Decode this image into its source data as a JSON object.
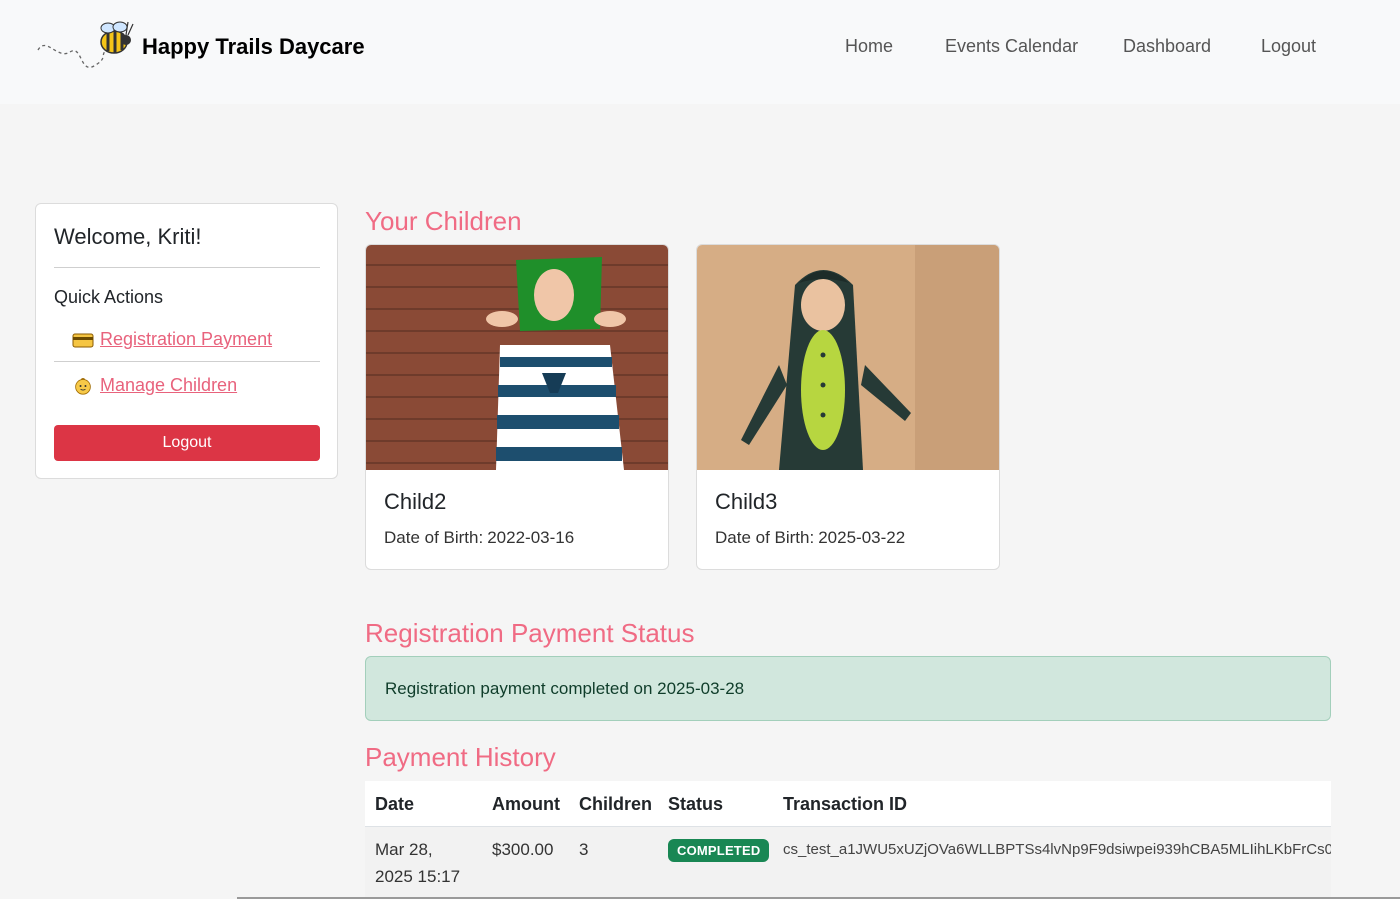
{
  "brand": {
    "name": "Happy Trails Daycare",
    "logo_icon": "bee-icon"
  },
  "nav": {
    "items": [
      {
        "label": "Home"
      },
      {
        "label": "Events Calendar"
      },
      {
        "label": "Dashboard"
      },
      {
        "label": "Logout"
      }
    ]
  },
  "sidebar": {
    "welcome": "Welcome, Kriti!",
    "quick_actions_title": "Quick Actions",
    "actions": [
      {
        "label": "Registration Payment",
        "icon": "credit-card-icon"
      },
      {
        "label": "Manage Children",
        "icon": "baby-icon"
      }
    ],
    "logout_label": "Logout"
  },
  "children_section": {
    "title": "Your Children",
    "children": [
      {
        "name": "Child2",
        "dob_label": "Date of Birth:",
        "dob": "2022-03-16"
      },
      {
        "name": "Child3",
        "dob_label": "Date of Birth:",
        "dob": "2025-03-22"
      }
    ]
  },
  "payment_status": {
    "title": "Registration Payment Status",
    "message": "Registration payment completed on 2025-03-28"
  },
  "payment_history": {
    "title": "Payment History",
    "columns": [
      "Date",
      "Amount",
      "Children",
      "Status",
      "Transaction ID"
    ],
    "rows": [
      {
        "date": "Mar 28, 2025 15:17",
        "amount": "$300.00",
        "children": "3",
        "status": "COMPLETED",
        "transaction_id": "cs_test_a1JWU5xUZjOVa6WLLBPTSs4lvNp9F9dsiwpei939hCBA5MLIihLKbFrCs0"
      }
    ]
  },
  "colors": {
    "accent": "#f06b84",
    "danger": "#dc3545",
    "success": "#198754",
    "alert_bg": "#d1e7dd"
  }
}
